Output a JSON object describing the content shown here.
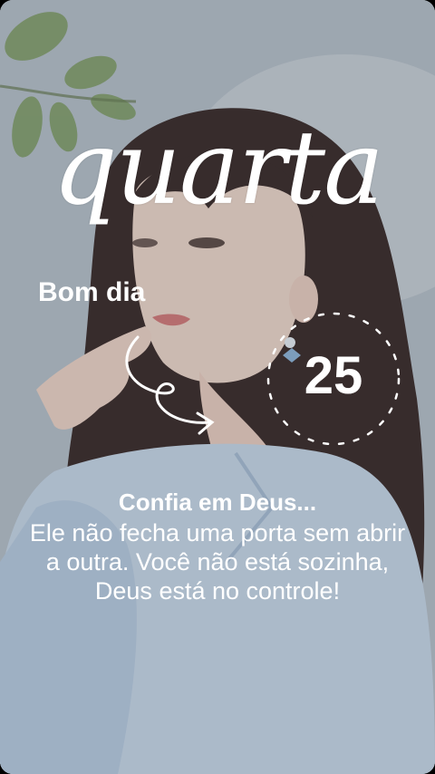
{
  "story": {
    "weekday_script": "quarta",
    "greeting": "Bom dia",
    "day_number": "25",
    "message_title": "Confia em Deus...",
    "message_body": "Ele não fecha uma porta sem abrir a outra. Você não está sozinha, Deus está no controle!"
  },
  "colors": {
    "text": "#ffffff",
    "leaf": "#7f9e63",
    "sky": "#c7cfd6",
    "shirt": "#c9d9ea",
    "hair": "#3b2c2a"
  }
}
